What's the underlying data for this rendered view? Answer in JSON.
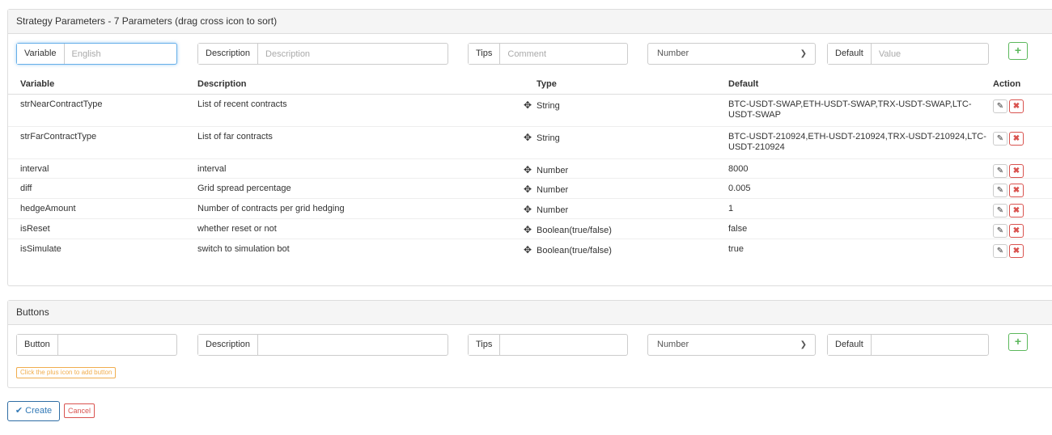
{
  "params_panel": {
    "title": "Strategy Parameters - 7 Parameters (drag cross icon to sort)",
    "form": {
      "variable_label": "Variable",
      "variable_value": "",
      "variable_placeholder": "English",
      "description_label": "Description",
      "description_placeholder": "Description",
      "tips_label": "Tips",
      "tips_placeholder": "Comment",
      "type_selected": "Number",
      "default_label": "Default",
      "default_placeholder": "Value",
      "add_label": "+"
    },
    "table": {
      "headers": [
        "Variable",
        "Description",
        "Type",
        "Default",
        "Action"
      ],
      "rows": [
        {
          "variable": "strNearContractType",
          "description": "List of recent contracts",
          "type": "String",
          "default": "BTC-USDT-SWAP,ETH-USDT-SWAP,TRX-USDT-SWAP,LTC-USDT-SWAP"
        },
        {
          "variable": "strFarContractType",
          "description": "List of far contracts",
          "type": "String",
          "default": "BTC-USDT-210924,ETH-USDT-210924,TRX-USDT-210924,LTC-USDT-210924"
        },
        {
          "variable": "interval",
          "description": "interval",
          "type": "Number",
          "default": "8000"
        },
        {
          "variable": "diff",
          "description": "Grid spread percentage",
          "type": "Number",
          "default": "0.005"
        },
        {
          "variable": "hedgeAmount",
          "description": "Number of contracts per grid hedging",
          "type": "Number",
          "default": "1"
        },
        {
          "variable": "isReset",
          "description": "whether reset or not",
          "type": "Boolean(true/false)",
          "default": "false"
        },
        {
          "variable": "isSimulate",
          "description": "switch to simulation bot",
          "type": "Boolean(true/false)",
          "default": "true"
        }
      ]
    }
  },
  "buttons_panel": {
    "title": "Buttons",
    "form": {
      "button_label": "Button",
      "description_label": "Description",
      "tips_label": "Tips",
      "type_selected": "Number",
      "default_label": "Default",
      "add_label": "+"
    },
    "hint": "Click the plus icon to add button"
  },
  "footer": {
    "create_label": "Create",
    "cancel_label": "Cancel"
  },
  "icons": {
    "drag": "move-cross-icon",
    "edit": "pencil-icon",
    "delete": "close-icon",
    "check": "check-icon"
  },
  "colors": {
    "primary": "#337ab7",
    "success": "#5cb85c",
    "danger": "#d9534f",
    "warning": "#f0ad4e",
    "focus": "#66afe9"
  }
}
